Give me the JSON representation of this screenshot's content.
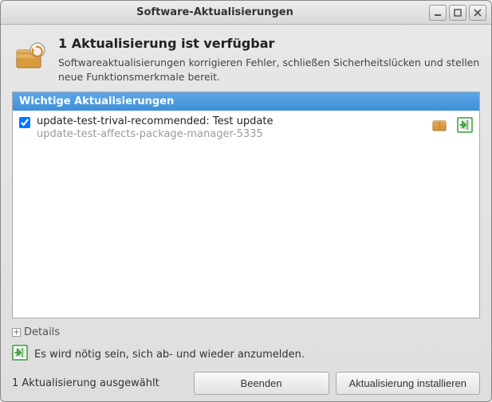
{
  "window": {
    "title": "Software-Aktualisierungen"
  },
  "header": {
    "heading": "1 Aktualisierung ist verfügbar",
    "description": "Softwareaktualisierungen korrigieren Fehler, schließen Sicherheitslücken und stellen neue Funktionsmerkmale bereit."
  },
  "list": {
    "section_header": "Wichtige Aktualisierungen",
    "items": [
      {
        "checked": true,
        "title": "update-test-trival-recommended: Test update",
        "subtitle": "update-test-affects-package-manager-5335"
      }
    ]
  },
  "details": {
    "label": "Details",
    "expander_glyph": "+"
  },
  "notice": {
    "text": "Es wird nötig sein, sich ab- und wieder anzumelden."
  },
  "footer": {
    "selection_label": "1 Aktualisierung ausgewählt",
    "quit_label": "Beenden",
    "install_label": "Aktualisierung installieren"
  },
  "colors": {
    "accent": "#3f8fd8"
  }
}
